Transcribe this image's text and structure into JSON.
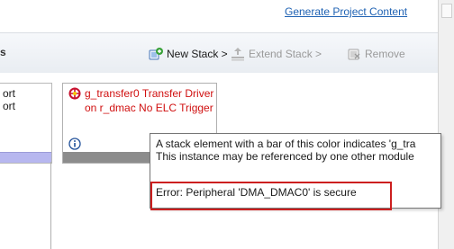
{
  "header": {
    "generate_link": "Generate Project Content"
  },
  "stacks_panel": {
    "title_fragment": "s",
    "toolbar": {
      "new_stack": "New Stack >",
      "extend_stack": "Extend Stack >",
      "remove": "Remove"
    }
  },
  "canvas": {
    "left_card": {
      "line1": "ort",
      "line2": "ort"
    },
    "card": {
      "title": "g_transfer0 Transfer Driver on r_dmac No ELC Trigger",
      "bar_color": "#8c8c8c",
      "title_color": "#d01010"
    }
  },
  "tooltip": {
    "line1": "A stack element with a bar of this color indicates 'g_tra",
    "line2": "This instance may be referenced by one other module",
    "error": "Error: Peripheral 'DMA_DMAC0' is secure"
  },
  "icons": [
    "add-stack-icon",
    "extend-stack-icon",
    "remove-icon",
    "component-icon",
    "info-icon"
  ],
  "colors": {
    "link": "#1f62b3",
    "error_highlight": "#cc1f1f",
    "left_bar": "#b7b7ef"
  }
}
